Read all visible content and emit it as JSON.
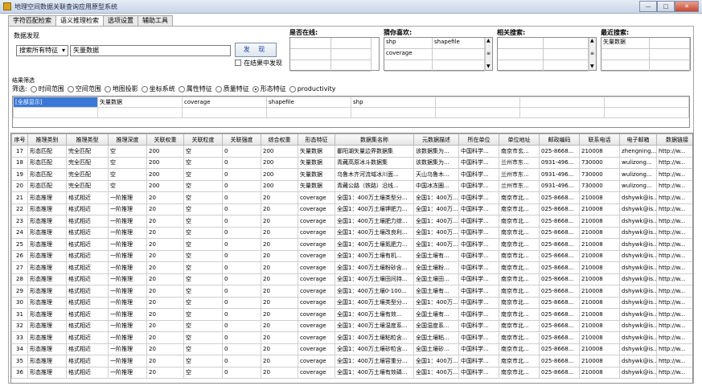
{
  "window": {
    "title": "地理空间数据关联查询应用原型系统",
    "minimize": "—",
    "maximize": "□",
    "close": "✕"
  },
  "tabs": [
    "字符匹配检索",
    "语义推理检索",
    "选项设置",
    "辅助工具"
  ],
  "search": {
    "group_label": "数据发现",
    "field_select": "搜索所有特征",
    "keyword": "矢量数据",
    "send_label": "发 现",
    "within_label": "在结果中发现"
  },
  "related": {
    "is_online_label": "是否在线:",
    "recommend_label": "猜你喜欢:",
    "recommend_items": [
      [
        "shp",
        "shapefile"
      ],
      [
        "coverage",
        ""
      ]
    ],
    "related_search_label": "相关搜索:",
    "recent_label": "最近搜索:",
    "recent_items": [
      "矢量数据"
    ]
  },
  "filter": {
    "section_label": "结果筛选",
    "prefix": "筛选:",
    "options": [
      "时间范围",
      "空间范围",
      "地图投影",
      "坐标系统",
      "属性特征",
      "质量特征",
      "形态特征",
      "productivity"
    ],
    "selected_index": 6
  },
  "results_tags": [
    "[全部显示]",
    "矢量数据",
    "coverage",
    "shapefile",
    "shp"
  ],
  "grid": {
    "columns": [
      "序号",
      "推理类别",
      "推理类型",
      "推理深度",
      "关联权重",
      "关联粒度",
      "关联强度",
      "综合权重",
      "形态特征",
      "数据集名称",
      "元数据描述",
      "所在单位",
      "单位地址",
      "邮政编码",
      "联系电话",
      "电子邮箱",
      "数据链接"
    ],
    "rows": [
      [
        "17",
        "形态匹配",
        "完全匹配",
        "空",
        "200",
        "空",
        "0",
        "200",
        "矢量数据",
        "鄱阳湖矢量边界数据集",
        "该数据集为...",
        "中国科学...",
        "南京市玄...",
        "025-8668...",
        "210008",
        "zhengning...",
        "http://w..."
      ],
      [
        "18",
        "形态匹配",
        "完全匹配",
        "空",
        "200",
        "空",
        "0",
        "200",
        "矢量数据",
        "青藏高原冰斗数据集",
        "该数据集为...",
        "中国科学...",
        "兰州市东...",
        "0931-496...",
        "730000",
        "wulizong...",
        "http://w..."
      ],
      [
        "19",
        "形态匹配",
        "完全匹配",
        "空",
        "200",
        "空",
        "0",
        "200",
        "矢量数据",
        "乌鲁木齐河流域冰川面...",
        "天山乌鲁木...",
        "中国科学...",
        "兰州市东...",
        "0931-496...",
        "730000",
        "wulizong...",
        "http://w..."
      ],
      [
        "20",
        "形态匹配",
        "完全匹配",
        "空",
        "200",
        "空",
        "0",
        "200",
        "矢量数据",
        "青藏公路（铁路）沿线...",
        "中国冰冻圈...",
        "中国科学...",
        "兰州市东...",
        "0931-496...",
        "730000",
        "wulizong...",
        "http://w..."
      ],
      [
        "21",
        "形态推理",
        "格式相近",
        "一阶推理",
        "20",
        "空",
        "0",
        "20",
        "coverage",
        "全国1：400万土壤类型分...",
        "全国1：400万...",
        "中国科学...",
        "南京市北...",
        "025-8668...",
        "210008",
        "dshywk@is...",
        "http://w..."
      ],
      [
        "22",
        "形态推理",
        "格式相近",
        "一阶推理",
        "20",
        "空",
        "0",
        "20",
        "coverage",
        "全国1：400万土壤钾肥力...",
        "全国1：400万...",
        "中国科学...",
        "南京市北...",
        "025-8668...",
        "210008",
        "dshywk@is...",
        "http://w..."
      ],
      [
        "23",
        "形态推理",
        "格式相近",
        "一阶推理",
        "20",
        "空",
        "0",
        "20",
        "coverage",
        "全国1：400万土壤肥力综...",
        "全国1：400万...",
        "中国科学...",
        "南京市北...",
        "025-8668...",
        "210008",
        "dshywk@is...",
        "http://w..."
      ],
      [
        "24",
        "形态推理",
        "格式相近",
        "一阶推理",
        "20",
        "空",
        "0",
        "20",
        "coverage",
        "全国1：400万土壤改良利...",
        "全国1：400万...",
        "中国科学...",
        "南京市北...",
        "025-8668...",
        "210008",
        "dshywk@is...",
        "http://w..."
      ],
      [
        "25",
        "形态推理",
        "格式相近",
        "一阶推理",
        "20",
        "空",
        "0",
        "20",
        "coverage",
        "全国1：400万土壤氮肥力...",
        "全国1：400万...",
        "中国科学...",
        "南京市北...",
        "025-8668...",
        "210008",
        "dshywk@is...",
        "http://w..."
      ],
      [
        "26",
        "形态推理",
        "格式相近",
        "一阶推理",
        "20",
        "空",
        "0",
        "20",
        "coverage",
        "全国1：400万土壤有机...",
        "全国土壤有...",
        "中国科学...",
        "南京市北...",
        "025-8668...",
        "210008",
        "dshywk@is...",
        "http://w..."
      ],
      [
        "27",
        "形态推理",
        "格式相近",
        "一阶推理",
        "20",
        "空",
        "0",
        "20",
        "coverage",
        "全国1：400万土壤粉砂含...",
        "全国土壤粉...",
        "中国科学...",
        "南京市北...",
        "025-8668...",
        "210008",
        "dshywk@is...",
        "http://w..."
      ],
      [
        "28",
        "形态推理",
        "格式相近",
        "一阶推理",
        "20",
        "空",
        "0",
        "20",
        "coverage",
        "全国1：400万土壤田间持...",
        "全国土壤田...",
        "中国科学...",
        "南京市北...",
        "025-8668...",
        "210008",
        "dshywk@is...",
        "http://w..."
      ],
      [
        "29",
        "形态推理",
        "格式相近",
        "一阶推理",
        "20",
        "空",
        "0",
        "20",
        "coverage",
        "全国1：400万土壤0-100...",
        "全国土壤有...",
        "中国科学...",
        "南京市北...",
        "025-8668...",
        "210008",
        "dshywk@is...",
        "http://w..."
      ],
      [
        "30",
        "形态推理",
        "格式相近",
        "一阶推理",
        "20",
        "空",
        "0",
        "20",
        "coverage",
        "全国1：400万土壤类型分...",
        "全国1：400万...",
        "中国科学...",
        "南京市北...",
        "025-8668...",
        "210008",
        "dshywk@is...",
        "http://w..."
      ],
      [
        "31",
        "形态推理",
        "格式相近",
        "一阶推理",
        "20",
        "空",
        "0",
        "20",
        "coverage",
        "全国1：400万土壤有效...",
        "全国土壤有...",
        "中国科学...",
        "南京市北...",
        "025-8668...",
        "210008",
        "dshywk@is...",
        "http://w..."
      ],
      [
        "32",
        "形态推理",
        "格式相近",
        "一阶推理",
        "20",
        "空",
        "0",
        "20",
        "coverage",
        "全国1：400万土壤湿度系...",
        "全国湿度系...",
        "中国科学...",
        "南京市北...",
        "025-8668...",
        "210008",
        "dshywk@is...",
        "http://w..."
      ],
      [
        "33",
        "形态推理",
        "格式相近",
        "一阶推理",
        "20",
        "空",
        "0",
        "20",
        "coverage",
        "全国1：400万土壤粘粒含...",
        "全国土壤粘...",
        "中国科学...",
        "南京市北...",
        "025-8668...",
        "210008",
        "dshywk@is...",
        "http://w..."
      ],
      [
        "34",
        "形态推理",
        "格式相近",
        "一阶推理",
        "20",
        "空",
        "0",
        "20",
        "coverage",
        "全国1：400万土壤砂粒含...",
        "全国土壤砂...",
        "中国科学...",
        "南京市北...",
        "025-8668...",
        "210008",
        "dshywk@is...",
        "http://w..."
      ],
      [
        "35",
        "形态推理",
        "格式相近",
        "一阶推理",
        "20",
        "空",
        "0",
        "20",
        "coverage",
        "全国1：400万土壤容重分...",
        "全国1：400万...",
        "中国科学...",
        "南京市北...",
        "025-8668...",
        "210008",
        "dshywk@is...",
        "http://w..."
      ],
      [
        "36",
        "形态推理",
        "格式相近",
        "一阶推理",
        "20",
        "空",
        "0",
        "20",
        "coverage",
        "全国1：400万土壤有效磷...",
        "全国1：400万...",
        "中国科学...",
        "南京市北...",
        "025-8668...",
        "210008",
        "dshywk@is...",
        "http://w..."
      ]
    ]
  },
  "colors": {
    "selected": "#3a78d8",
    "link": "#1a44aa"
  }
}
